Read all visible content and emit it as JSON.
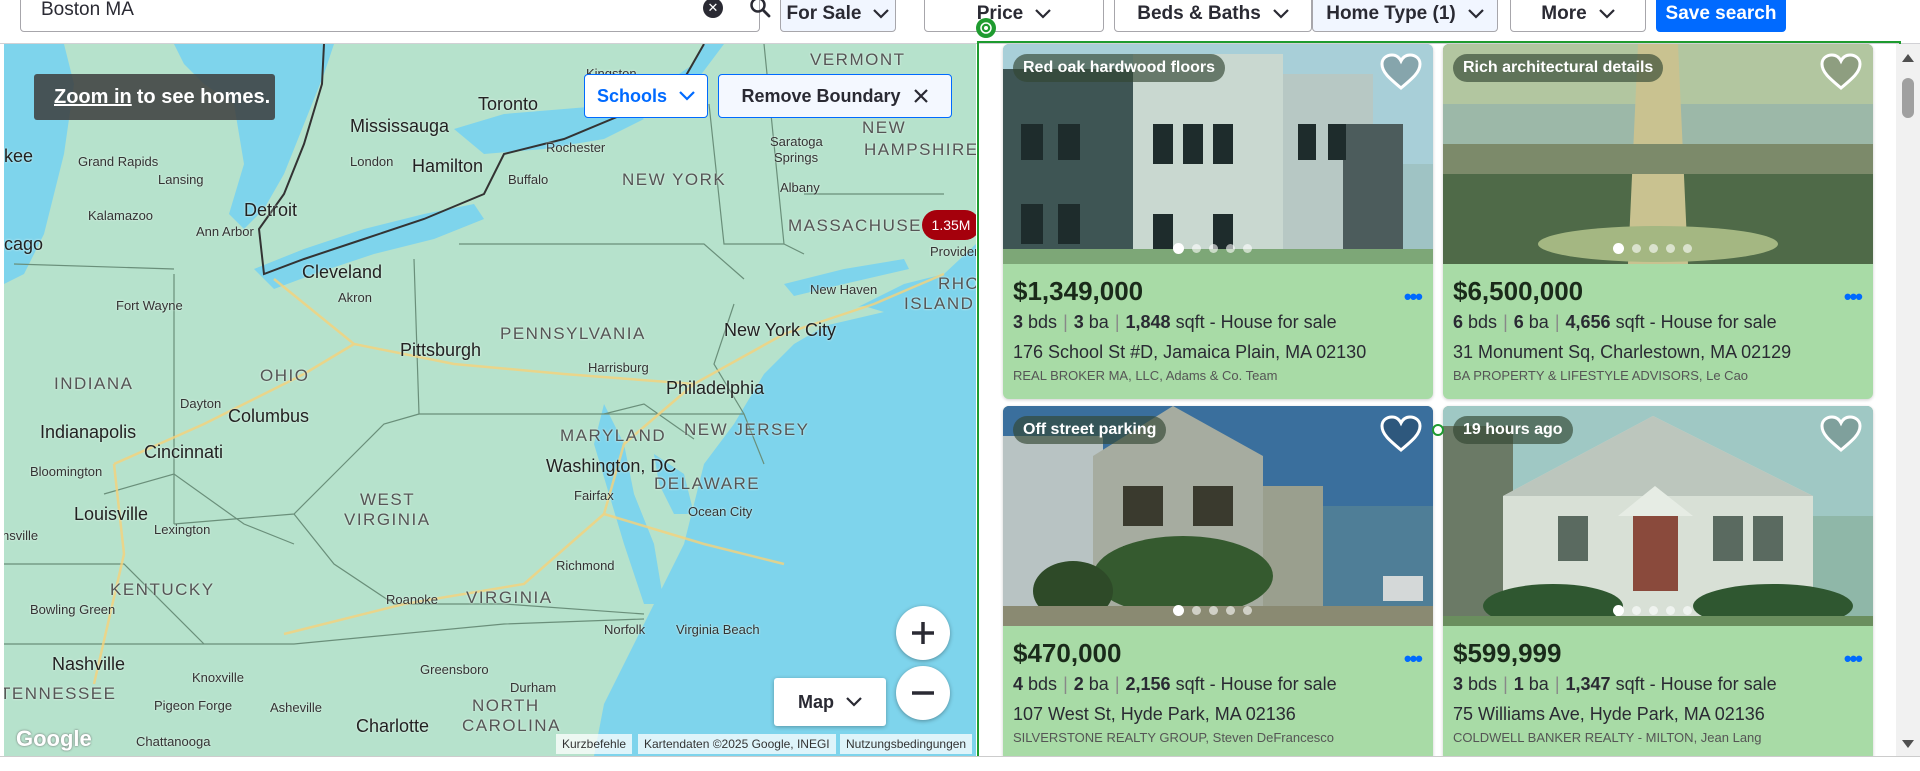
{
  "search": {
    "value": "Boston MA"
  },
  "filters": [
    {
      "label": "For Sale",
      "active": true
    },
    {
      "label": "Price",
      "active": false
    },
    {
      "label": "Beds & Baths",
      "active": false
    },
    {
      "label": "Home Type (1)",
      "active": true
    },
    {
      "label": "More",
      "active": false
    }
  ],
  "save_search_label": "Save search",
  "map": {
    "zoom_hint_link": "Zoom in",
    "zoom_hint_rest": "to see homes.",
    "schools_label": "Schools",
    "remove_boundary_label": "Remove Boundary",
    "price_pin": "1.35M",
    "map_type_label": "Map",
    "google_logo": "Google",
    "attribution": {
      "shortcuts": "Kurzbefehle",
      "data": "Kartendaten ©2025 Google, INEGI",
      "terms": "Nutzungsbedingungen"
    },
    "labels": {
      "vermont": "VERMONT",
      "new_hampshire_1": "NEW",
      "new_hampshire_2": "HAMPSHIRE",
      "new_york_state": "NEW YORK",
      "massachusetts": "MASSACHUSE",
      "rhode_island_1": "RHODE",
      "rhode_island_2": "ISLAND",
      "pennsylvania": "PENNSYLVANIA",
      "new_jersey": "NEW JERSEY",
      "maryland": "MARYLAND",
      "delaware": "DELAWARE",
      "ohio": "OHIO",
      "indiana": "INDIANA",
      "west_virginia_1": "WEST",
      "west_virginia_2": "VIRGINIA",
      "virginia": "VIRGINIA",
      "kentucky": "KENTUCKY",
      "tennessee": "TENNESSEE",
      "north_carolina_1": "NORTH",
      "north_carolina_2": "CAROLINA",
      "kingston": "Kingston",
      "toronto": "Toronto",
      "mississauga": "Mississauga",
      "hamilton": "Hamilton",
      "london": "London",
      "buffalo": "Buffalo",
      "rochester": "Rochester",
      "saratoga_1": "Saratoga",
      "saratoga_2": "Springs",
      "albany": "Albany",
      "grand_rapids": "Grand Rapids",
      "lansing": "Lansing",
      "detroit": "Detroit",
      "kalamazoo": "Kalamazoo",
      "ann_arbor": "Ann Arbor",
      "kee": "kee",
      "cago": "cago",
      "cleveland": "Cleveland",
      "akron": "Akron",
      "providence": "Providence",
      "new_haven": "New Haven",
      "new_york_city": "New York City",
      "fort_wayne": "Fort Wayne",
      "pittsburgh": "Pittsburgh",
      "harrisburg": "Harrisburg",
      "philadelphia": "Philadelphia",
      "dayton": "Dayton",
      "columbus": "Columbus",
      "indianapolis": "Indianapolis",
      "cincinnati": "Cincinnati",
      "bloomington": "Bloomington",
      "washington": "Washington, DC",
      "fairfax": "Fairfax",
      "ocean_city": "Ocean City",
      "louisville": "Louisville",
      "lexington": "Lexington",
      "nsville": "nsville",
      "richmond": "Richmond",
      "roanoke": "Roanoke",
      "norfolk": "Norfolk",
      "virginia_beach": "Virginia Beach",
      "bowling_green": "Bowling Green",
      "nashville": "Nashville",
      "knoxville": "Knoxville",
      "greensboro": "Greensboro",
      "durham": "Durham",
      "pigeon_forge": "Pigeon Forge",
      "asheville": "Asheville",
      "charlotte": "Charlotte",
      "chattanooga": "Chattanooga"
    }
  },
  "listings": [
    {
      "tag": "Red oak hardwood floors",
      "price": "$1,349,000",
      "beds": "3",
      "beds_unit": "bds",
      "baths": "3",
      "baths_unit": "ba",
      "sqft": "1,848",
      "sqft_unit": "sqft",
      "type": "- House for sale",
      "address": "176 School St #D, Jamaica Plain, MA 02130",
      "broker": "REAL BROKER MA, LLC",
      "agent": ", Adams & Co. Team"
    },
    {
      "tag": "Rich architectural details",
      "price": "$6,500,000",
      "beds": "6",
      "beds_unit": "bds",
      "baths": "6",
      "baths_unit": "ba",
      "sqft": "4,656",
      "sqft_unit": "sqft",
      "type": "- House for sale",
      "address": "31 Monument Sq, Charlestown, MA 02129",
      "broker": "BA PROPERTY & LIFESTYLE ADVISORS",
      "agent": ", Le Cao"
    },
    {
      "tag": "Off street parking",
      "price": "$470,000",
      "beds": "4",
      "beds_unit": "bds",
      "baths": "2",
      "baths_unit": "ba",
      "sqft": "2,156",
      "sqft_unit": "sqft",
      "type": "- House for sale",
      "address": "107 West St, Hyde Park, MA 02136",
      "broker": "SILVERSTONE REALTY GROUP",
      "agent": ", Steven DeFrancesco"
    },
    {
      "tag": "19 hours ago",
      "price": "$599,999",
      "beds": "3",
      "beds_unit": "bds",
      "baths": "1",
      "baths_unit": "ba",
      "sqft": "1,347",
      "sqft_unit": "sqft",
      "type": "- House for sale",
      "address": "75 Williams Ave, Hyde Park, MA 02136",
      "broker": "COLDWELL BANKER REALTY - MILTON",
      "agent": ", Jean Lang"
    }
  ],
  "colors": {
    "accent": "#006aff",
    "price_pin": "#a5000c",
    "highlight": "#1e9b2f"
  }
}
